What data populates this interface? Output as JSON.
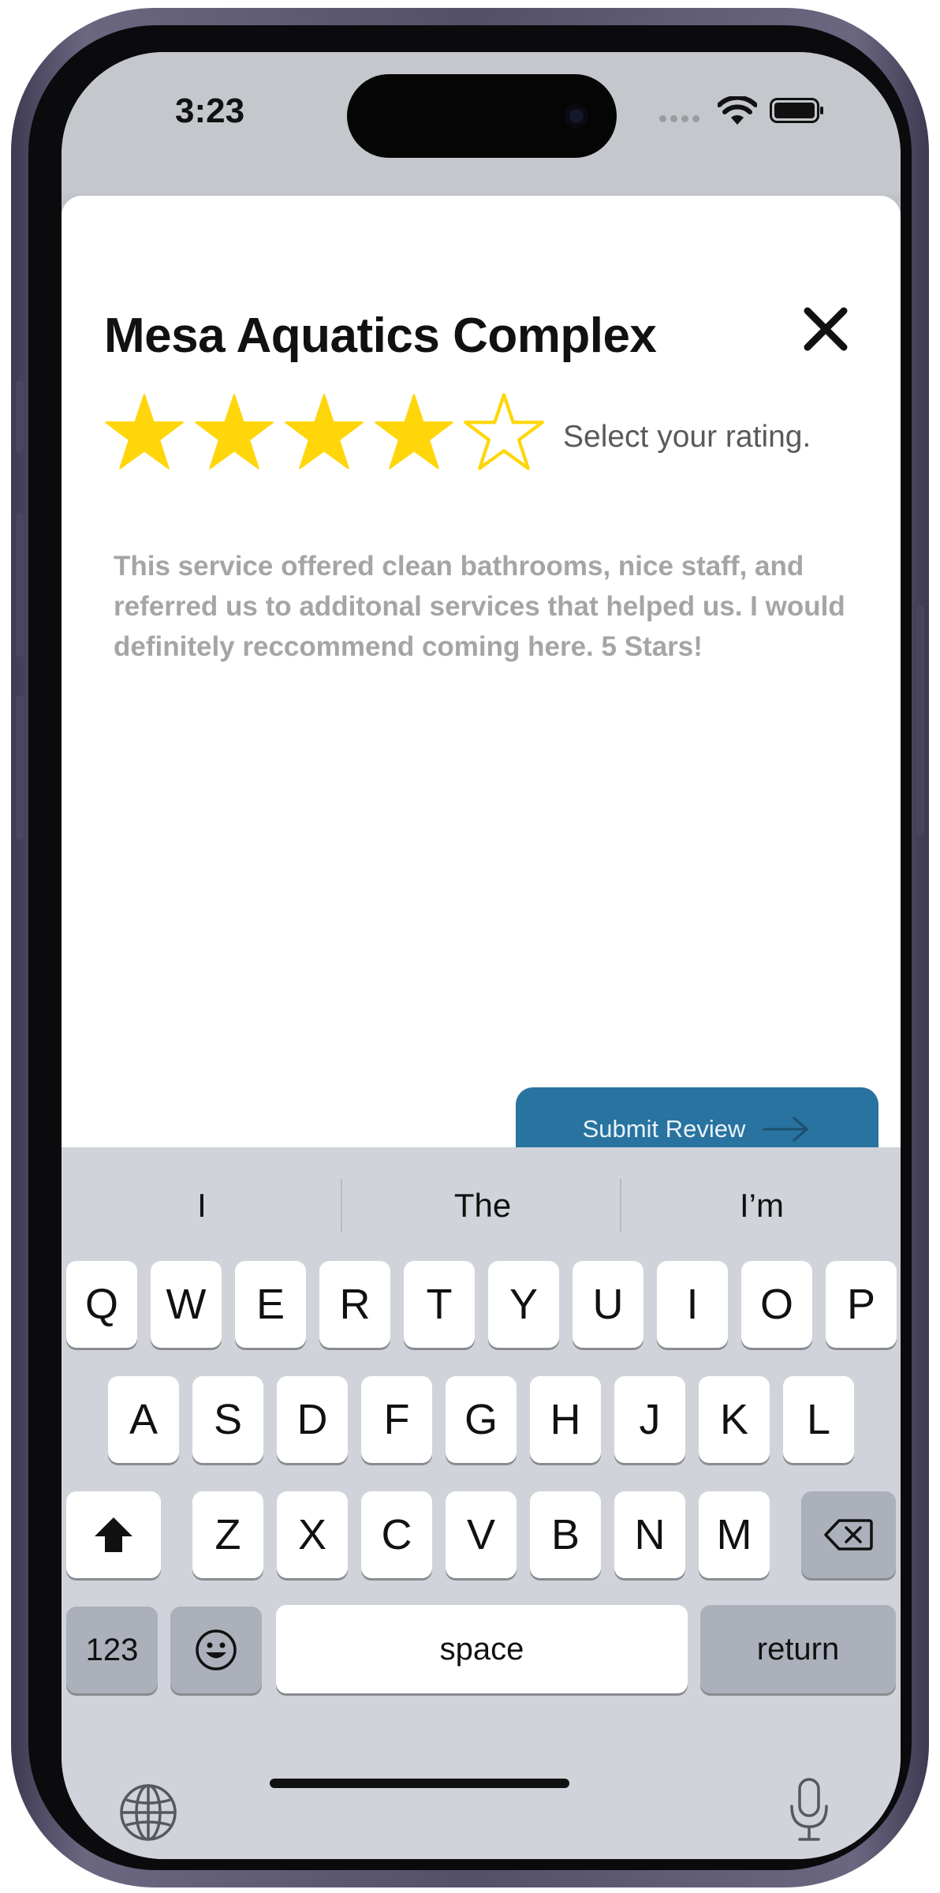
{
  "status_bar": {
    "time": "3:23"
  },
  "review": {
    "title": "Mesa Aquatics Complex",
    "rating_value": 4,
    "rating_max": 5,
    "rating_hint": "Select your rating.",
    "review_text": "This service offered clean bathrooms, nice staff, and referred us to additonal services that helped us. I would definitely reccommend coming here. 5 Stars!",
    "submit_label": "Submit Review",
    "star_color": "#ffd60a",
    "button_color": "#2873a0"
  },
  "keyboard": {
    "suggestions": [
      "I",
      "The",
      "I’m"
    ],
    "row1": [
      "Q",
      "W",
      "E",
      "R",
      "T",
      "Y",
      "U",
      "I",
      "O",
      "P"
    ],
    "row2": [
      "A",
      "S",
      "D",
      "F",
      "G",
      "H",
      "J",
      "K",
      "L"
    ],
    "row3": [
      "Z",
      "X",
      "C",
      "V",
      "B",
      "N",
      "M"
    ],
    "numbers_label": "123",
    "space_label": "space",
    "return_label": "return"
  }
}
